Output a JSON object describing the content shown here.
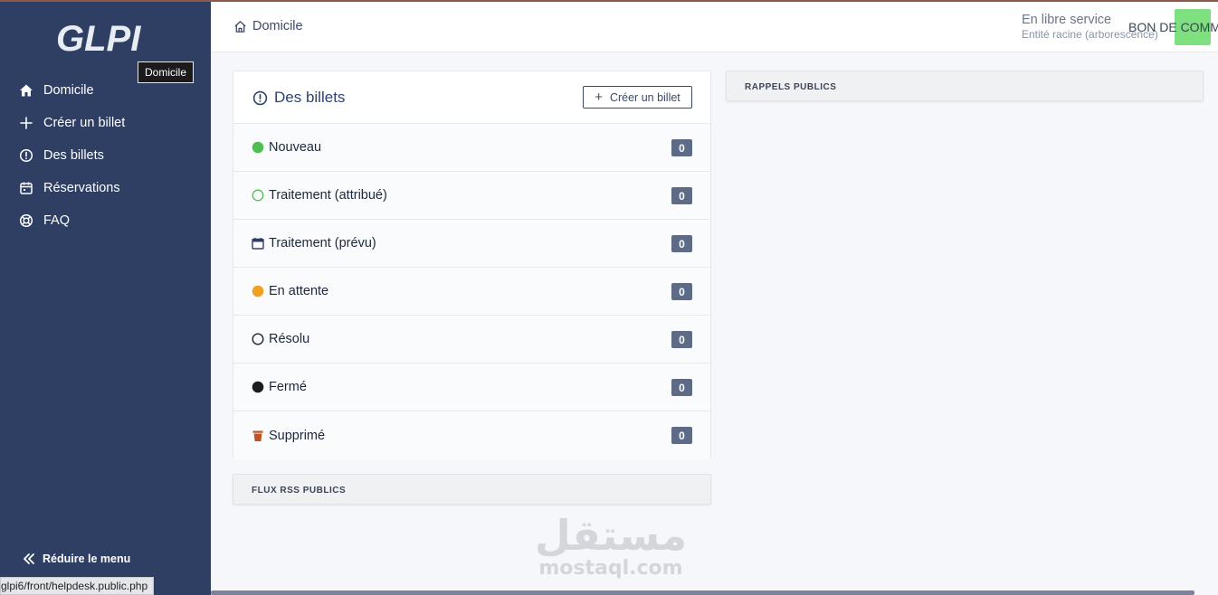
{
  "app": {
    "logo_text": "GLPI"
  },
  "sidebar": {
    "tooltip": "Domicile",
    "items": [
      {
        "label": "Domicile",
        "icon": "home-icon"
      },
      {
        "label": "Créer un billet",
        "icon": "plus-icon"
      },
      {
        "label": "Des billets",
        "icon": "alert-circle-icon"
      },
      {
        "label": "Réservations",
        "icon": "calendar-icon"
      },
      {
        "label": "FAQ",
        "icon": "lifebuoy-icon"
      }
    ],
    "collapse_label": "Réduire le menu"
  },
  "status_bar": {
    "url": "glpi6/front/helpdesk.public.php"
  },
  "header": {
    "breadcrumb": "Domicile",
    "profile_name": "En libre service",
    "entity": "Entité racine (arborescence)",
    "username": "BON DE COMM",
    "avatar_color": "#7ee07e"
  },
  "tickets": {
    "title": "Des billets",
    "create_button": "Créer un billet",
    "rows": [
      {
        "label": "Nouveau",
        "count": "0",
        "icon": "green-dot-icon",
        "color": "#4fbf4f"
      },
      {
        "label": "Traitement (attribué)",
        "count": "0",
        "icon": "green-ring-icon",
        "color": "#4fbf4f"
      },
      {
        "label": "Traitement (prévu)",
        "count": "0",
        "icon": "calendar-icon",
        "color": "#2f3f64"
      },
      {
        "label": "En attente",
        "count": "0",
        "icon": "orange-dot-icon",
        "color": "#f0a020"
      },
      {
        "label": "Résolu",
        "count": "0",
        "icon": "black-ring-icon",
        "color": "#1d273b"
      },
      {
        "label": "Fermé",
        "count": "0",
        "icon": "black-dot-icon",
        "color": "#1d1d1d"
      },
      {
        "label": "Supprimé",
        "count": "0",
        "icon": "trash-icon",
        "color": "#c0522a"
      }
    ]
  },
  "panels": {
    "rss_title": "FLUX RSS PUBLICS",
    "reminders_title": "RAPPELS PUBLICS"
  },
  "watermark": {
    "arabic": "مستقل",
    "latin": "mostaql.com"
  }
}
